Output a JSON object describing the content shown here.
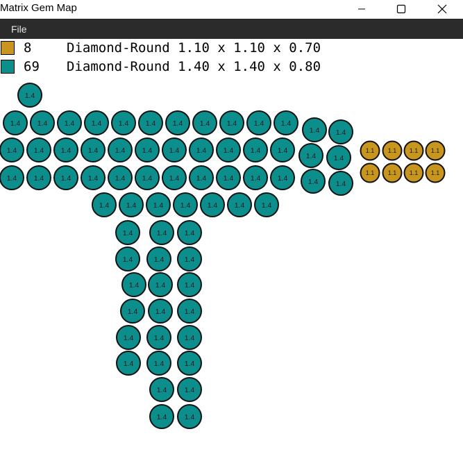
{
  "window": {
    "title": "Matrix Gem Map"
  },
  "menu": {
    "file_label": "File"
  },
  "legend": [
    {
      "count": "8",
      "description": "Diamond-Round 1.10 x 1.10 x 0.70",
      "color": "#c8961e"
    },
    {
      "count": "69",
      "description": "Diamond-Round 1.40 x 1.40 x 0.80",
      "color": "#0b8e8c"
    }
  ],
  "gem_groups": [
    {
      "label": "1.1",
      "fill": "#c8961e",
      "count": 8
    },
    {
      "label": "1.4",
      "fill": "#0b8e8c",
      "count": 69
    }
  ]
}
